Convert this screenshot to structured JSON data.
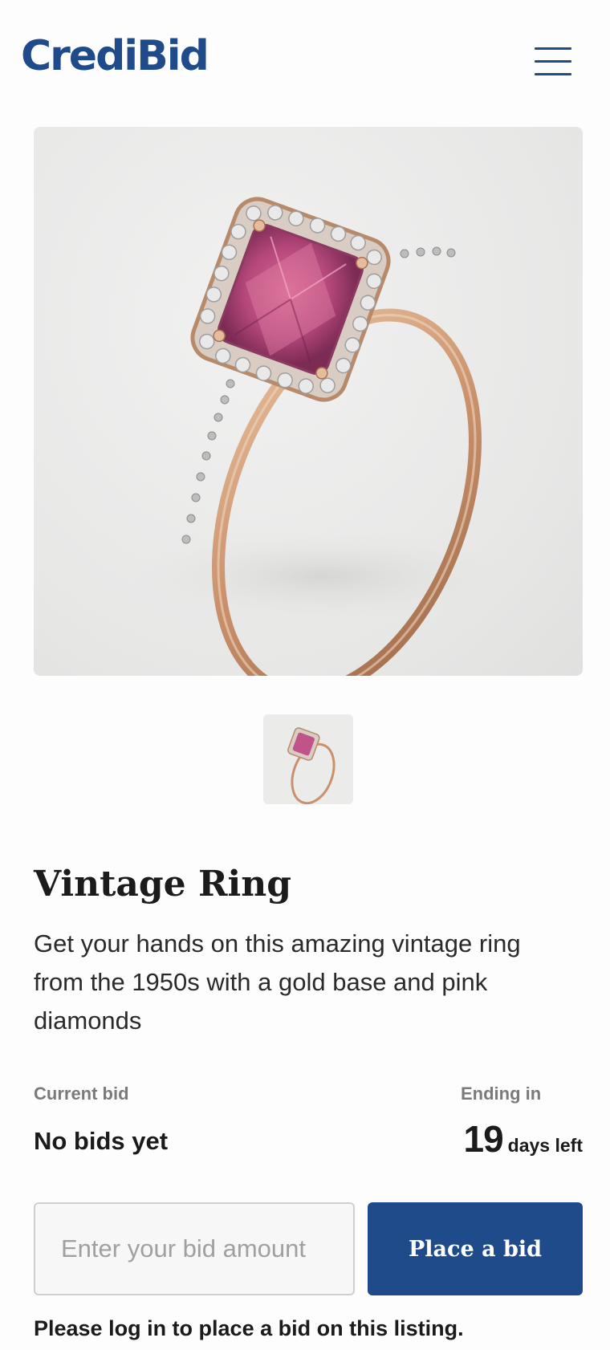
{
  "header": {
    "logo": "CrediBid",
    "menu_icon": "hamburger-menu-icon"
  },
  "listing": {
    "image_subject": "ring-photo",
    "title": "Vintage Ring",
    "description": "Get your hands on this amazing vintage ring from the 1950s with a gold base and pink diamonds"
  },
  "bid_info": {
    "current_label": "Current bid",
    "current_value": "No bids yet",
    "ending_label": "Ending in",
    "ending_number": "19",
    "ending_unit": "days left"
  },
  "bid_form": {
    "placeholder": "Enter your bid amount",
    "button_label": "Place a bid",
    "login_note": "Please log in to place a bid on this listing."
  },
  "colors": {
    "brand": "#1f4b8a",
    "gem": "#b5487a",
    "gold": "#c9916b"
  }
}
